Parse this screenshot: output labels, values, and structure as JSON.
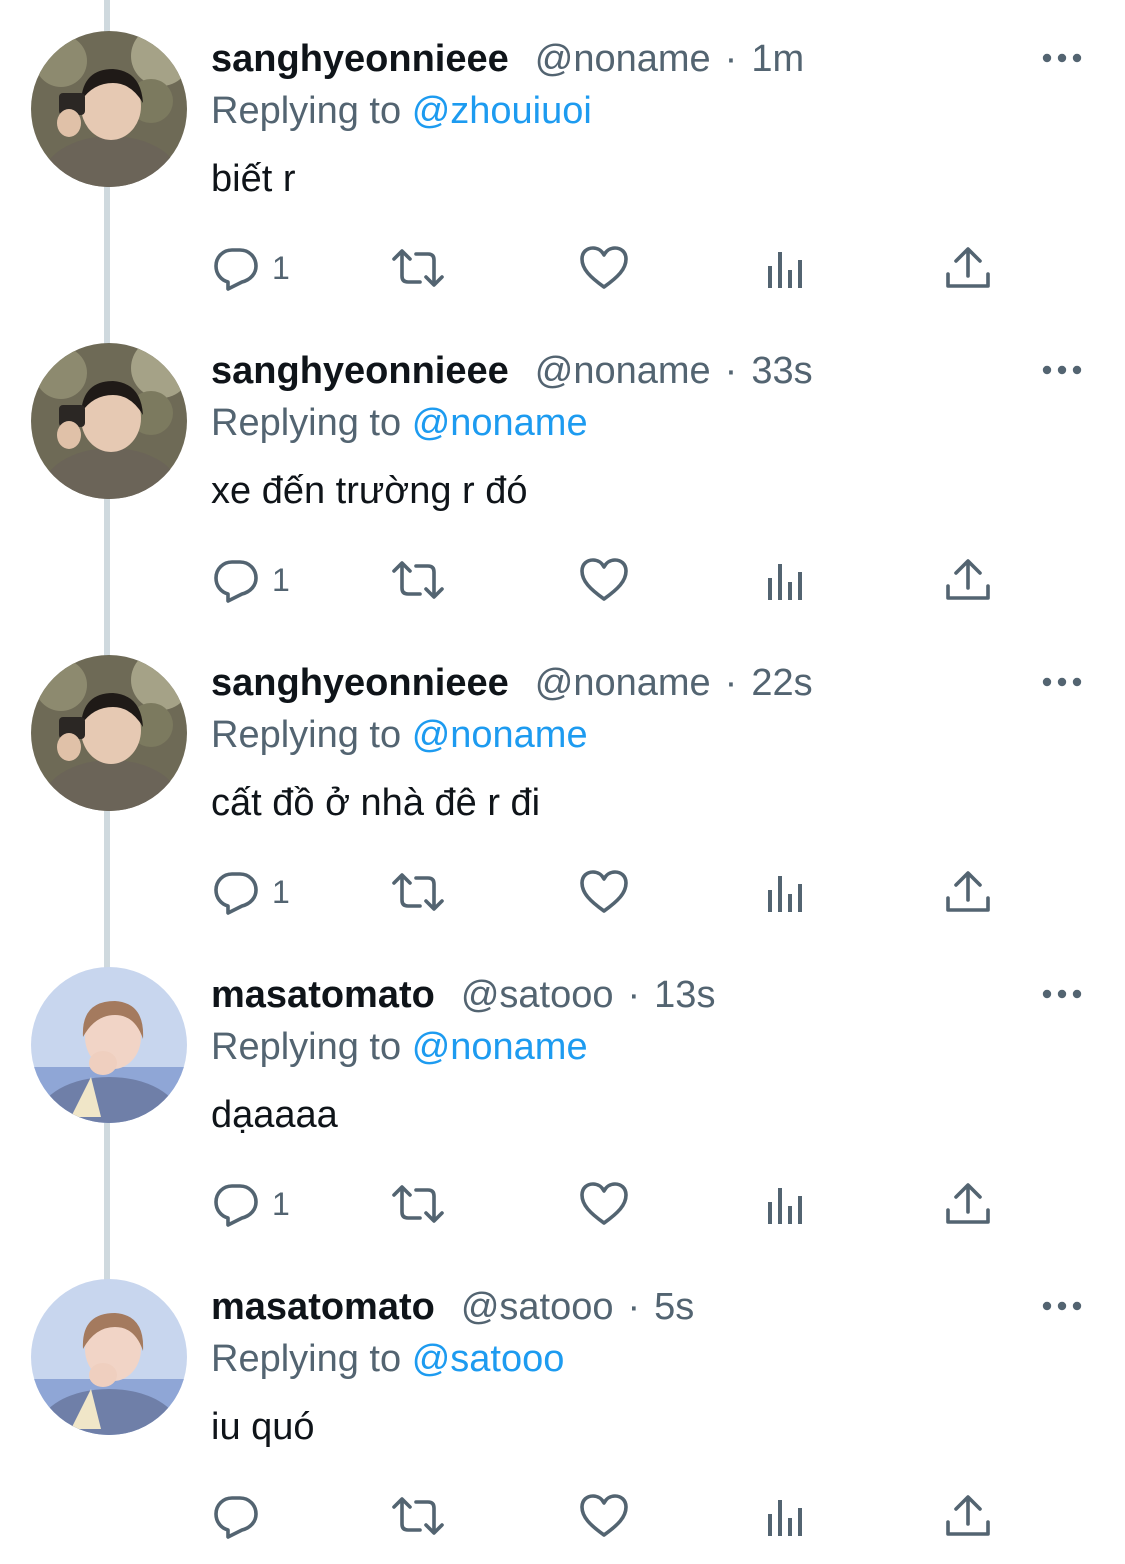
{
  "tweets": [
    {
      "display_name": "sanghyeonnieee",
      "handle": "@noname",
      "dot": "·",
      "time": "1m",
      "replying_prefix": "Replying to",
      "replying_to": "@zhouiuoi",
      "text": "biết r",
      "reply_count": "1",
      "avatar": "sanghyeon"
    },
    {
      "display_name": "sanghyeonnieee",
      "handle": "@noname",
      "dot": "·",
      "time": "33s",
      "replying_prefix": "Replying to",
      "replying_to": "@noname",
      "text": "xe đến trường r đó",
      "reply_count": "1",
      "avatar": "sanghyeon"
    },
    {
      "display_name": "sanghyeonnieee",
      "handle": "@noname",
      "dot": "·",
      "time": "22s",
      "replying_prefix": "Replying to",
      "replying_to": "@noname",
      "text": "cất đồ ở nhà đê r đi",
      "reply_count": "1",
      "avatar": "sanghyeon"
    },
    {
      "display_name": "masatomato",
      "handle": "@satooo",
      "dot": "·",
      "time": "13s",
      "replying_prefix": "Replying to",
      "replying_to": "@noname",
      "text": "dạaaaa",
      "reply_count": "1",
      "avatar": "masato"
    },
    {
      "display_name": "masatomato",
      "handle": "@satooo",
      "dot": "·",
      "time": "5s",
      "replying_prefix": "Replying to",
      "replying_to": "@satooo",
      "text": "iu quó",
      "reply_count": "",
      "avatar": "masato"
    }
  ],
  "icons": {
    "more": "more-horizontal-icon",
    "reply": "reply-bubble-icon",
    "retweet": "retweet-icon",
    "like": "heart-icon",
    "views": "views-bar-chart-icon",
    "share": "share-upload-icon"
  },
  "colors": {
    "text_primary": "#0f1419",
    "text_secondary": "#536471",
    "link": "#1d9bf0",
    "icon": "#536471",
    "thread_line": "#cfd9de"
  }
}
